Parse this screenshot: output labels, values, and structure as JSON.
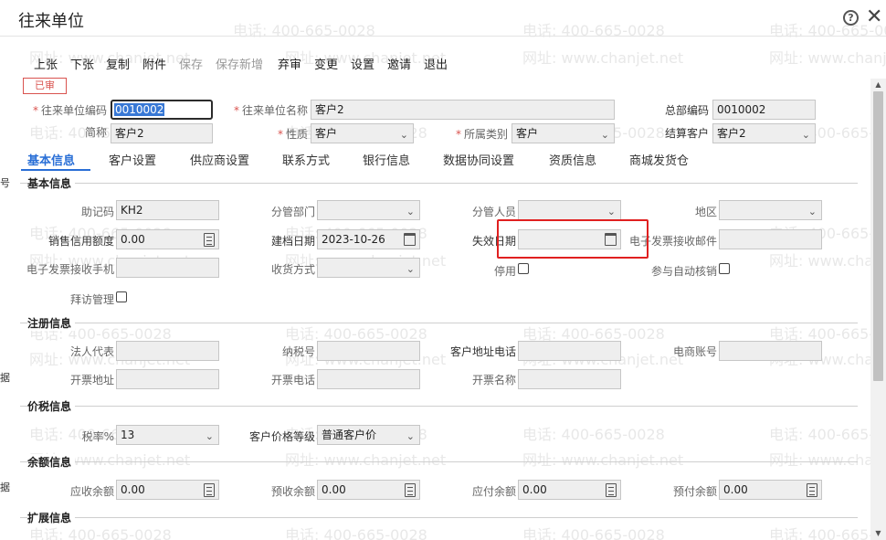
{
  "window": {
    "title": "往来单位",
    "help_icon": "question-circle-icon",
    "close_icon": "close-icon"
  },
  "watermark": {
    "phone": "电话: 400-665-0028",
    "site": "网址: www.chanjet.net"
  },
  "toolbar": {
    "prev": "上张",
    "next": "下张",
    "copy": "复制",
    "attach": "附件",
    "save": "保存",
    "save_new": "保存新增",
    "discard": "弃审",
    "change": "变更",
    "settings": "设置",
    "invite": "邀请",
    "exit": "退出"
  },
  "status_badge": "已审",
  "header_fields": {
    "code_label": "往来单位编码",
    "code_value": "0010002",
    "name_label": "往来单位名称",
    "name_value": "客户2",
    "hq_label": "总部编码",
    "hq_value": "0010002",
    "short_label": "简称",
    "short_value": "客户2",
    "nature_label": "性质",
    "nature_value": "客户",
    "category_label": "所属类别",
    "category_value": "客户",
    "settle_label": "结算客户",
    "settle_value": "客户2"
  },
  "tabs": [
    "基本信息",
    "客户设置",
    "供应商设置",
    "联系方式",
    "银行信息",
    "数据协同设置",
    "资质信息",
    "商城发货仓"
  ],
  "sections": {
    "basic": "基本信息",
    "register": "注册信息",
    "price_tax": "价税信息",
    "balance": "余额信息",
    "extend": "扩展信息"
  },
  "basic": {
    "mnemonic_label": "助记码",
    "mnemonic_value": "KH2",
    "dept_label": "分管部门",
    "staff_label": "分管人员",
    "region_label": "地区",
    "credit_label": "销售信用额度",
    "credit_value": "0.00",
    "created_label": "建档日期",
    "created_value": "2023-10-26",
    "expire_label": "失效日期",
    "einv_mail_label": "电子发票接收邮件",
    "einv_phone_label": "电子发票接收手机",
    "ship_label": "收货方式",
    "disabled_label": "停用",
    "auto_verify_label": "参与自动核销",
    "visit_label": "拜访管理"
  },
  "register": {
    "legal_label": "法人代表",
    "tax_label": "纳税号",
    "addr_phone_label": "客户地址电话",
    "ecom_label": "电商账号",
    "inv_addr_label": "开票地址",
    "inv_phone_label": "开票电话",
    "inv_name_label": "开票名称"
  },
  "price_tax": {
    "tax_rate_label": "税率%",
    "tax_rate_value": "13",
    "price_level_label": "客户价格等级",
    "price_level_value": "普通客户价"
  },
  "balance": {
    "ar_label": "应收余额",
    "ar_value": "0.00",
    "adv_recv_label": "预收余额",
    "adv_recv_value": "0.00",
    "ap_label": "应付余额",
    "ap_value": "0.00",
    "adv_pay_label": "预付余额",
    "adv_pay_value": "0.00"
  },
  "left_marks": [
    "号",
    "据",
    "据"
  ]
}
